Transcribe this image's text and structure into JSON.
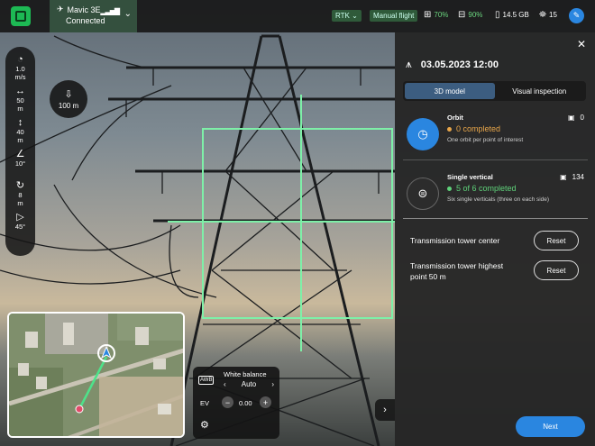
{
  "topbar": {
    "drone_name": "Mavic 3E",
    "drone_status": "Connected",
    "rtk_label": "RTK",
    "mode_label": "Manual flight",
    "controller_battery": "70%",
    "drone_battery": "90%",
    "storage": "14.5 GB",
    "satellites": "15"
  },
  "params": {
    "speed_value": "1.0",
    "speed_unit": "m/s",
    "h_dist_value": "50",
    "h_dist_unit": "m",
    "v_dist_value": "40",
    "v_dist_unit": "m",
    "angle_value": "10°",
    "rot_value": "8",
    "rot_unit": "m",
    "fov_value": "45°"
  },
  "height_badge": {
    "value": "100 m"
  },
  "camera_settings": {
    "awb_label": "AWB",
    "wb_title": "White balance",
    "wb_value": "Auto",
    "ev_label": "EV",
    "ev_value": "0.00"
  },
  "panel": {
    "date": "03.05.2023 12:00",
    "tabs": [
      "3D model",
      "Visual inspection"
    ],
    "active_tab": "3D model",
    "orbit": {
      "title": "Orbit",
      "progress": "0 completed",
      "desc": "One orbit per point of interest",
      "count": "0",
      "dot_color": "#e8a64a"
    },
    "single_vertical": {
      "title": "Single vertical",
      "progress": "5 of 6 completed",
      "desc": "Six single verticals (three on each side)",
      "count": "134",
      "dot_color": "#5fd27a"
    },
    "reset_rows": [
      {
        "label": "Transmission tower center",
        "button": "Reset"
      },
      {
        "label": "Transmission tower highest point 50 m",
        "button": "Reset"
      }
    ],
    "next_label": "Next"
  },
  "colors": {
    "accent_blue": "#2a86e0",
    "grid_green": "#7ef0a8",
    "connected_bg": "#34503e"
  }
}
